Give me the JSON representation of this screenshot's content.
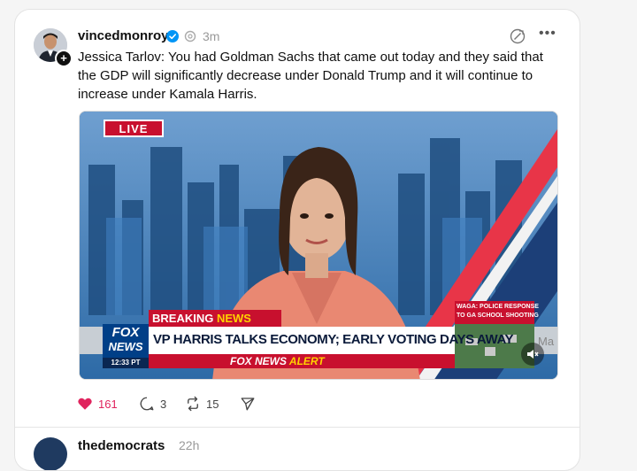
{
  "post": {
    "username": "vincedmonroy",
    "time": "3m",
    "text": "Jessica Tarlov: You had Goldman Sachs that came out today and they said that the GDP will significantly decrease under Donald Trump and it will continue to increase under Kamala Harris.",
    "video": {
      "live_label": "LIVE",
      "breaking": "BREAKING",
      "breaking_news": "NEWS",
      "headline": "VP HARRIS TALKS ECONOMY; EARLY VOTING DAYS AWAY",
      "network_top": "FOX",
      "network_bottom": "NEWS",
      "clock": "12:33 PT",
      "alert_brand": "FOX NEWS",
      "alert_word": "ALERT",
      "side_caption_1": "WAGA: POLICE RESPONSE",
      "side_caption_2": "TO GA SCHOOL SHOOTING",
      "edge_text": "Ma"
    },
    "likes": "161",
    "replies": "3",
    "reposts": "15",
    "colors": {
      "like": "#e0245e",
      "verified": "#0095f6",
      "fox_red": "#c8102e",
      "fox_blue": "#003f87"
    }
  },
  "next_post": {
    "username": "thedemocrats",
    "time": "22h"
  }
}
